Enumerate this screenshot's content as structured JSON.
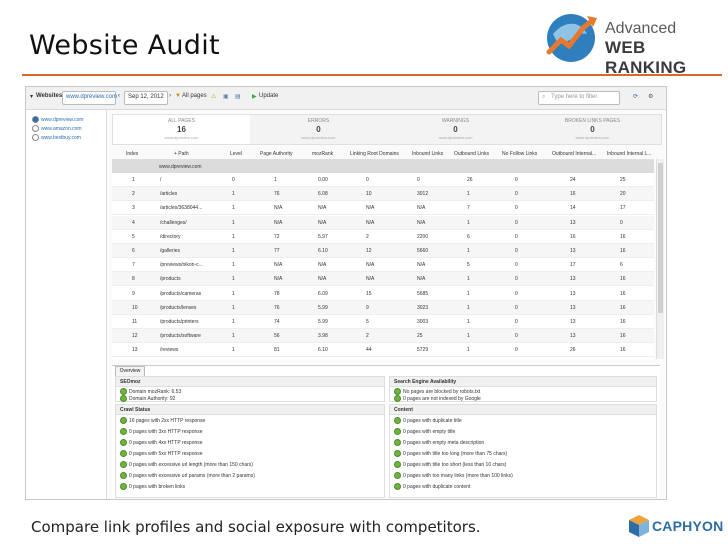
{
  "slide": {
    "title": "Website Audit",
    "caption": "Compare link profiles and social exposure with competitors.",
    "brand_line1": "Advanced",
    "brand_line2": "WEB RANKING",
    "footer_brand": "CAPHYON",
    "accent_color": "#d56a2b"
  },
  "toolbar": {
    "websites_label": "Websites",
    "site_select": "www.dpreview.com",
    "date": "Sep 12, 2012",
    "filter_all": "All pages",
    "update_label": "Update",
    "filter_placeholder": "Type here to filter"
  },
  "sidebar": {
    "sites": [
      "www.dpreview.com",
      "www.amazon.com",
      "www.bestbuy.com"
    ]
  },
  "stats": [
    {
      "label": "ALL PAGES",
      "value": "16",
      "sub": "www.dpreview.com"
    },
    {
      "label": "ERRORS",
      "value": "0",
      "sub": "www.dpreview.com"
    },
    {
      "label": "WARNINGS",
      "value": "0",
      "sub": "www.dpreview.com"
    },
    {
      "label": "BROKEN LINKS PAGES",
      "value": "0",
      "sub": "www.dpreview.com"
    }
  ],
  "grid": {
    "columns": [
      "Index",
      "+ Path",
      "Level",
      "Page Authority",
      "mozRank",
      "Linking Root Domains",
      "Inbound Links",
      "Outbound Links",
      "No Follow Links",
      "Outbound Internal...",
      "Inbound Internal L..."
    ],
    "root": "www.dpreview.com",
    "rows": [
      [
        "1",
        "/",
        "0",
        "1",
        "0.00",
        "0",
        "0",
        "26",
        "0",
        "24",
        "25"
      ],
      [
        "2",
        "/articles",
        "1",
        "76",
        "6.08",
        "10",
        "3012",
        "1",
        "0",
        "16",
        "20"
      ],
      [
        "3",
        "/articles/3638044...",
        "1",
        "N/A",
        "N/A",
        "N/A",
        "N/A",
        "7",
        "0",
        "14",
        "17"
      ],
      [
        "4",
        "/challenges/",
        "1",
        "N/A",
        "N/A",
        "N/A",
        "N/A",
        "1",
        "0",
        "13",
        "0"
      ],
      [
        "5",
        "/directory",
        "1",
        "72",
        "5.97",
        "2",
        "2200",
        "6",
        "0",
        "16",
        "16"
      ],
      [
        "6",
        "/galleries",
        "1",
        "77",
        "6.10",
        "12",
        "5660",
        "1",
        "0",
        "13",
        "16"
      ],
      [
        "7",
        "/previews/nikon-c...",
        "1",
        "N/A",
        "N/A",
        "N/A",
        "N/A",
        "5",
        "0",
        "17",
        "6"
      ],
      [
        "8",
        "/products",
        "1",
        "N/A",
        "N/A",
        "N/A",
        "N/A",
        "1",
        "0",
        "13",
        "16"
      ],
      [
        "9",
        "/products/cameras",
        "1",
        "78",
        "6.09",
        "15",
        "5685",
        "1",
        "0",
        "13",
        "16"
      ],
      [
        "10",
        "/products/lenses",
        "1",
        "76",
        "5.99",
        "9",
        "3023",
        "1",
        "0",
        "13",
        "16"
      ],
      [
        "11",
        "/products/printers",
        "1",
        "74",
        "5.99",
        "5",
        "3003",
        "1",
        "0",
        "13",
        "16"
      ],
      [
        "12",
        "/products/software",
        "1",
        "56",
        "3.98",
        "2",
        "25",
        "1",
        "0",
        "13",
        "16"
      ],
      [
        "13",
        "/reviews",
        "1",
        "81",
        "6.10",
        "44",
        "5729",
        "1",
        "0",
        "26",
        "16"
      ]
    ]
  },
  "overview": {
    "tab": "Overview",
    "seomoz": {
      "title": "SEOmoz",
      "items": [
        "Domain mozRank: 6.53",
        "Domain Authority: 92"
      ]
    },
    "search_engine": {
      "title": "Search Engine Availability",
      "items": [
        "No pages are blocked by robots.txt",
        "0 pages are not indexed by Google"
      ]
    },
    "crawl": {
      "title": "Crawl Status",
      "items": [
        "16 pages with 2xx HTTP response",
        "0 pages with 3xx HTTP response",
        "0 pages with 4xx HTTP response",
        "0 pages with 5xx HTTP response",
        "0 pages with excessive url length (more than 150 chars)",
        "0 pages with excessive url params (more than 2 params)",
        "0 pages with broken links"
      ]
    },
    "content": {
      "title": "Content",
      "items": [
        "0 pages with duplicate title",
        "0 pages with empty title",
        "0 pages with empty meta description",
        "0 pages with title too long (more than 75 chars)",
        "0 pages with title too short (less than 10 chars)",
        "0 pages with too many links (more than 100 links)",
        "0 pages with duplicate content"
      ]
    }
  }
}
